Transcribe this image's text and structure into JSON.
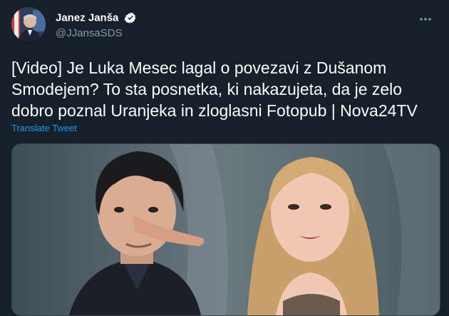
{
  "author": {
    "display_name": "Janez Janša",
    "handle": "@JJansaSDS",
    "avatar_icon": "person-avatar",
    "verified_icon": "verified-badge-icon"
  },
  "menu": {
    "more_icon": "more-options-icon"
  },
  "tweet": {
    "text": "[Video] Je Luka Mesec lagal o povezavi z Dušanom Smodejem? To sta posnetka, ki nakazujeta, da je zelo dobro poznal Uranjeka in zloglasni Fotopub | Nova24TV",
    "translate_label": "Translate Tweet"
  },
  "colors": {
    "background": "#15202b",
    "text": "#ffffff",
    "secondary_text": "#8b98a5",
    "link": "#1d9bf0",
    "verified": "#ffffff"
  }
}
